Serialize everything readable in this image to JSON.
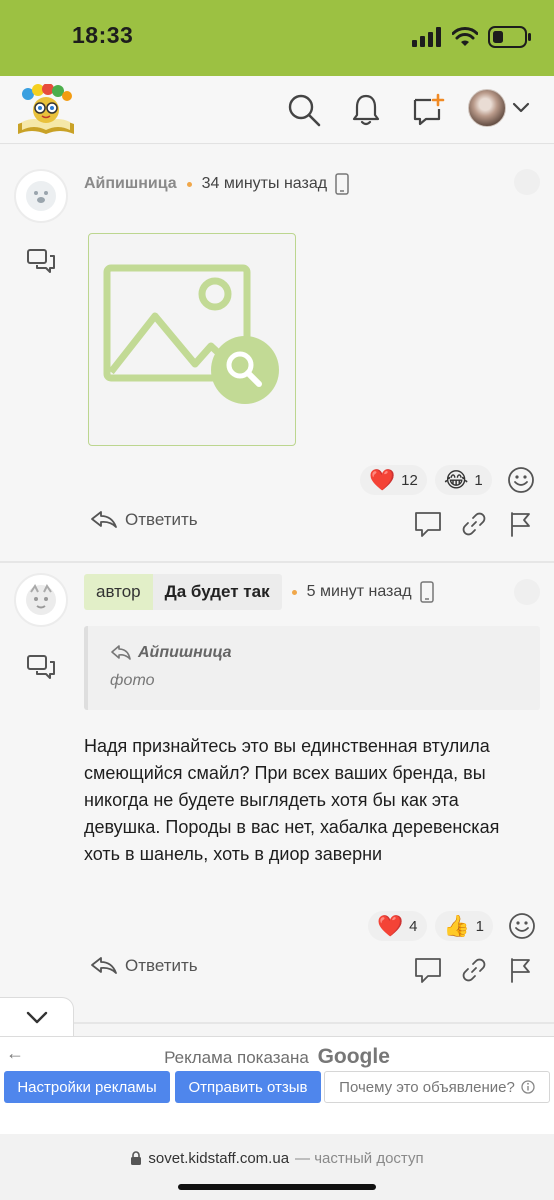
{
  "status_bar": {
    "time": "18:33"
  },
  "comments": [
    {
      "author": "Айпишница",
      "time": "34 минуты назад",
      "image_placeholder": "photo",
      "reactions": [
        {
          "emoji": "❤️",
          "count": "12"
        },
        {
          "emoji": "😂",
          "count": "1"
        }
      ],
      "reply_label": "Ответить"
    },
    {
      "author_badge": "автор",
      "author": "Да будет так",
      "time": "5 минут назад",
      "quote": {
        "author": "Айпишница",
        "text": "фото"
      },
      "text": "Надя признайтесь это вы единственная втулила смеющийся смайл? При всех ваших бренда, вы никогда не будете выглядеть хотя бы как эта девушка. Породы в вас нет, хабалка деревенская хоть в шанель, хоть в диор заверни",
      "reactions": [
        {
          "emoji": "❤️",
          "count": "4"
        },
        {
          "emoji": "👍",
          "count": "1"
        }
      ],
      "reply_label": "Ответить"
    }
  ],
  "ad": {
    "title_prefix": "Реклама показана",
    "title_brand": "Google",
    "buttons": [
      "Настройки рекламы",
      "Отправить отзыв",
      "Почему это объявление?"
    ]
  },
  "browser": {
    "domain": "sovet.kidstaff.com.ua",
    "suffix": "— частный доступ"
  },
  "colors": {
    "brand_green": "#9cc142",
    "accent_orange": "#f0a74a",
    "ad_blue": "#4f86ec"
  }
}
